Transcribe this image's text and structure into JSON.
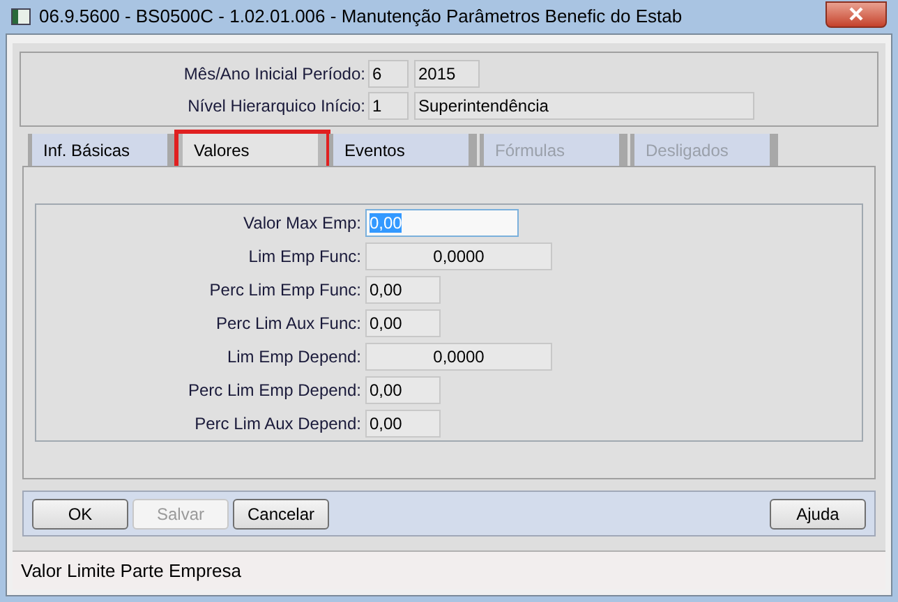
{
  "window": {
    "title": "06.9.5600 - BS0500C - 1.02.01.006 - Manutenção Parâmetros Benefic do Estab"
  },
  "header_fields": [
    {
      "label": "Mês/Ano Inicial Período:",
      "values": [
        "6",
        "2015"
      ]
    },
    {
      "label": "Nível Hierarquico Início:",
      "values": [
        "1",
        "Superintendência"
      ]
    }
  ],
  "tabs": [
    {
      "label": "Inf. Básicas",
      "selected": false,
      "disabled": false,
      "highlighted": false
    },
    {
      "label": "Valores",
      "selected": true,
      "disabled": false,
      "highlighted": true
    },
    {
      "label": "Eventos",
      "selected": false,
      "disabled": false,
      "highlighted": false
    },
    {
      "label": "Fórmulas",
      "selected": false,
      "disabled": true,
      "highlighted": false
    },
    {
      "label": "Desligados",
      "selected": false,
      "disabled": true,
      "highlighted": false
    }
  ],
  "fields": [
    {
      "label": "Valor Max Emp:",
      "value": "0,00",
      "kind": "medium",
      "selected": true
    },
    {
      "label": "Lim Emp Func:",
      "value": "0,0000",
      "kind": "long",
      "selected": false
    },
    {
      "label": "Perc Lim Emp Func:",
      "value": "0,00",
      "kind": "short",
      "selected": false
    },
    {
      "label": "Perc Lim Aux Func:",
      "value": "0,00",
      "kind": "short",
      "selected": false
    },
    {
      "label": "Lim Emp Depend:",
      "value": "0,0000",
      "kind": "long",
      "selected": false
    },
    {
      "label": "Perc Lim Emp Depend:",
      "value": "0,00",
      "kind": "short",
      "selected": false
    },
    {
      "label": "Perc Lim Aux Depend:",
      "value": "0,00",
      "kind": "short",
      "selected": false
    }
  ],
  "buttons_left": [
    {
      "label": "OK",
      "disabled": false
    },
    {
      "label": "Salvar",
      "disabled": true
    },
    {
      "label": "Cancelar",
      "disabled": false
    }
  ],
  "buttons_right": [
    {
      "label": "Ajuda",
      "disabled": false
    }
  ],
  "status_bar": {
    "text": "Valor Limite Parte Empresa"
  }
}
